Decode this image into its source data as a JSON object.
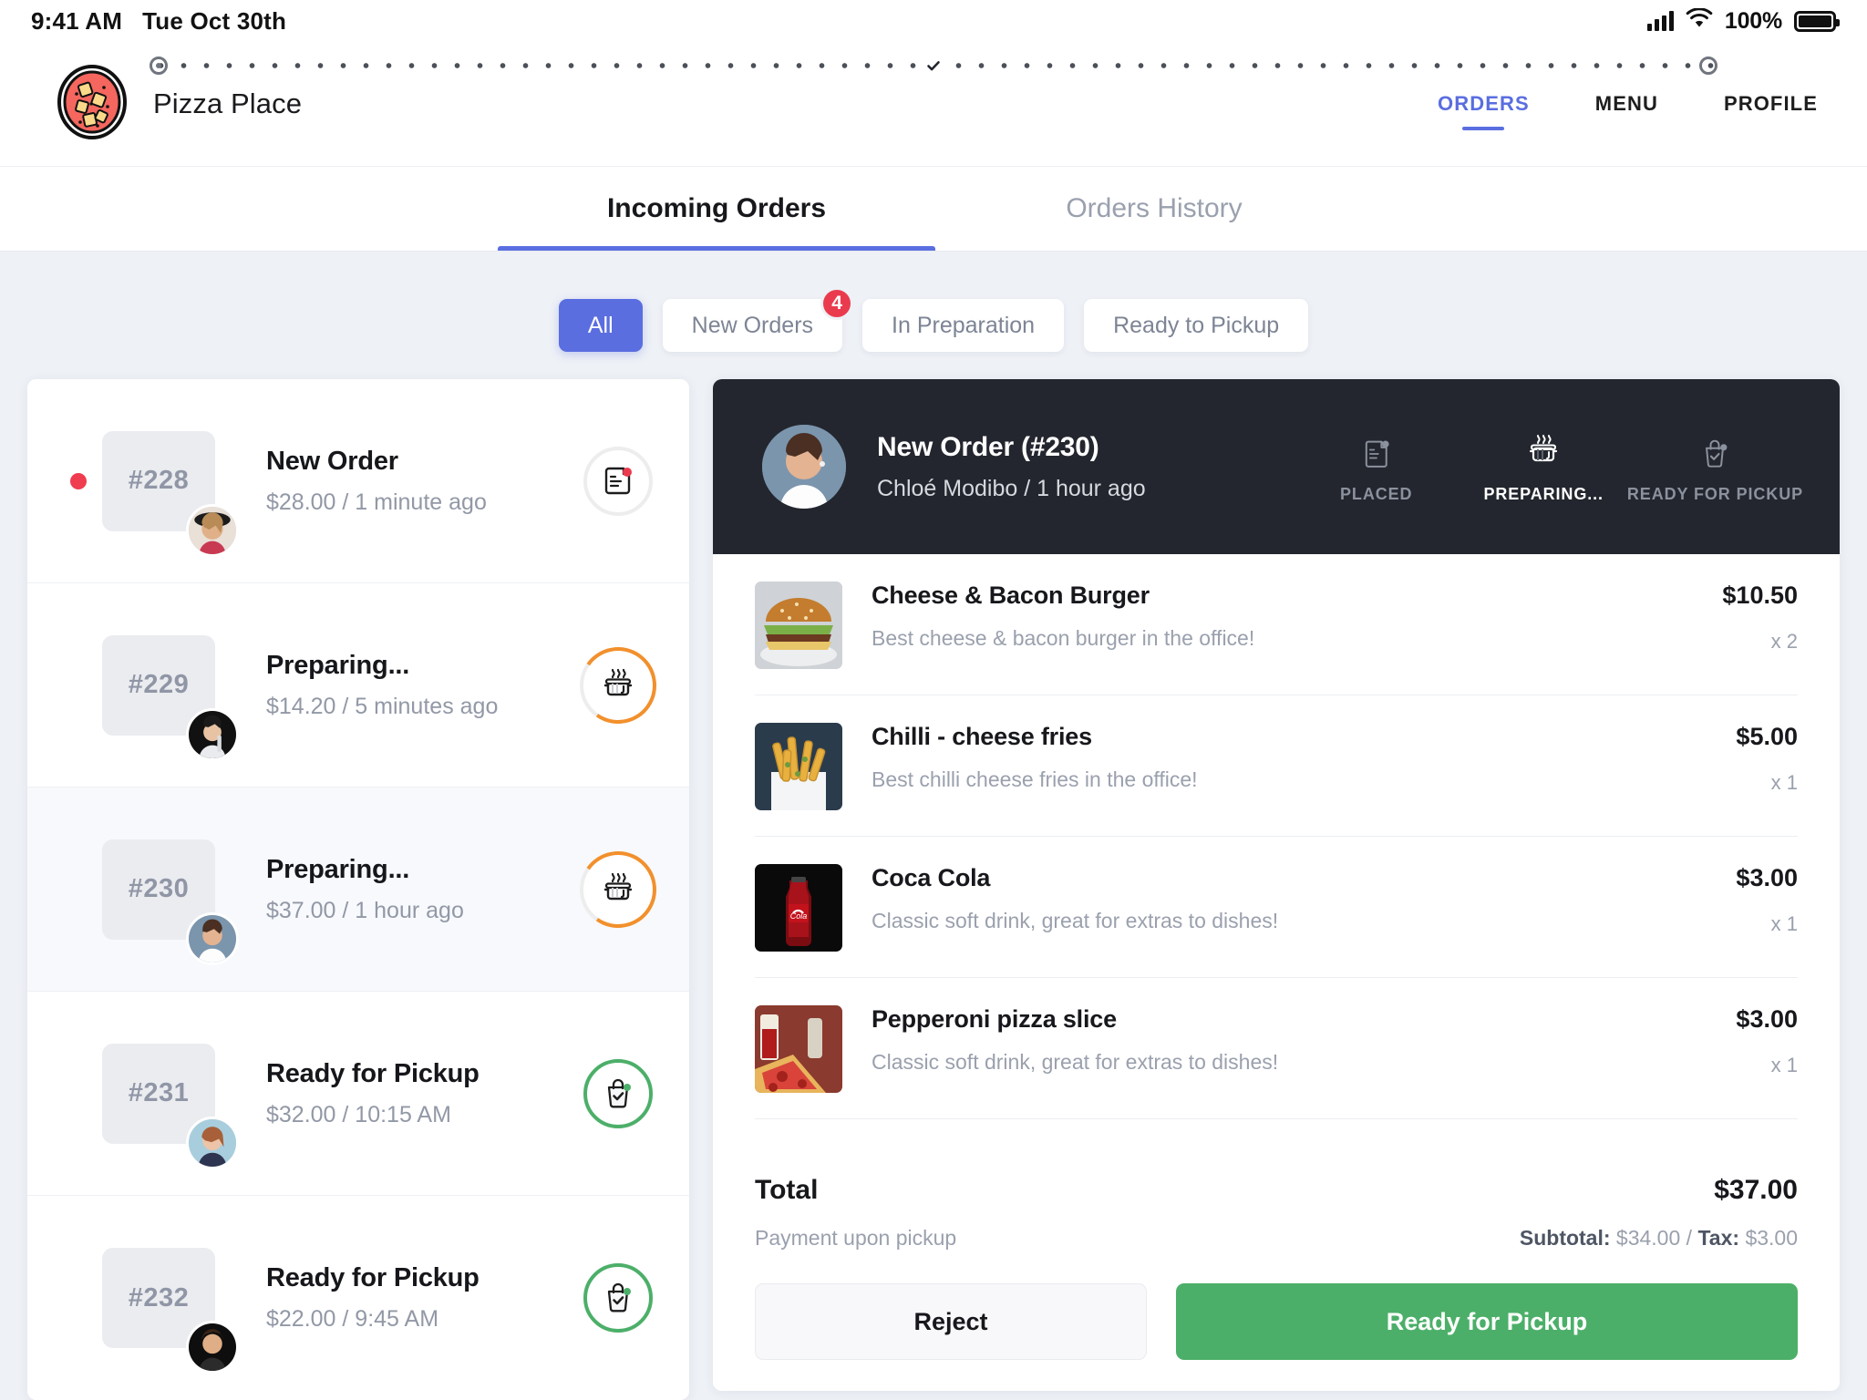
{
  "status_bar": {
    "time": "9:41 AM",
    "date": "Tue Oct 30th",
    "battery_percent": "100%",
    "signal_icon": "cellular-signal-icon",
    "wifi_icon": "wifi-icon",
    "battery_icon": "battery-full-icon"
  },
  "header": {
    "logo_icon": "pizza-logo-icon",
    "brand": "Pizza Place",
    "nav": [
      {
        "label": "ORDERS",
        "active": true
      },
      {
        "label": "MENU",
        "active": false
      },
      {
        "label": "PROFILE",
        "active": false
      }
    ]
  },
  "tabs": [
    {
      "label": "Incoming Orders",
      "active": true
    },
    {
      "label": "Orders History",
      "active": false
    }
  ],
  "filters": [
    {
      "label": "All",
      "active": true,
      "badge": ""
    },
    {
      "label": "New Orders",
      "active": false,
      "badge": "4"
    },
    {
      "label": "In Preparation",
      "active": false,
      "badge": ""
    },
    {
      "label": "Ready to Pickup",
      "active": false,
      "badge": ""
    }
  ],
  "orders": [
    {
      "number": "#228",
      "title": "New Order",
      "meta": "$28.00 / 1 minute ago",
      "status": "new",
      "icon": "receipt-icon",
      "selected": false,
      "unread": true
    },
    {
      "number": "#229",
      "title": "Preparing...",
      "meta": "$14.20 / 5 minutes ago",
      "status": "preparing",
      "icon": "cooking-pot-icon",
      "selected": false,
      "unread": false
    },
    {
      "number": "#230",
      "title": "Preparing...",
      "meta": "$37.00 / 1 hour ago",
      "status": "preparing",
      "icon": "cooking-pot-icon",
      "selected": true,
      "unread": false
    },
    {
      "number": "#231",
      "title": "Ready for Pickup",
      "meta": "$32.00 / 10:15 AM",
      "status": "ready",
      "icon": "shopping-bag-check-icon",
      "selected": false,
      "unread": false
    },
    {
      "number": "#232",
      "title": "Ready for Pickup",
      "meta": "$22.00 / 9:45 AM",
      "status": "ready",
      "icon": "shopping-bag-check-icon",
      "selected": false,
      "unread": false
    }
  ],
  "detail": {
    "title": "New Order (#230)",
    "subtitle": "Chloé Modibo / 1 hour ago",
    "customer_avatar": "customer-avatar",
    "steps": [
      {
        "label": "PLACED",
        "icon": "receipt-icon",
        "state": "done"
      },
      {
        "label": "PREPARING...",
        "icon": "cooking-pot-icon",
        "state": "current"
      },
      {
        "label": "READY FOR PICKUP",
        "icon": "shopping-bag-check-icon",
        "state": "pending"
      }
    ],
    "items": [
      {
        "name": "Cheese & Bacon Burger",
        "desc": "Best cheese & bacon burger in the office!",
        "price": "$10.50",
        "qty": "x 2",
        "image": "burger-photo"
      },
      {
        "name": "Chilli - cheese fries",
        "desc": "Best chilli cheese fries in the office!",
        "price": "$5.00",
        "qty": "x 1",
        "image": "fries-photo"
      },
      {
        "name": "Coca Cola",
        "desc": "Classic soft drink, great for extras to dishes!",
        "price": "$3.00",
        "qty": "x 1",
        "image": "cola-photo"
      },
      {
        "name": "Pepperoni pizza slice",
        "desc": "Classic soft drink, great for extras to dishes!",
        "price": "$3.00",
        "qty": "x 1",
        "image": "pizza-photo"
      }
    ],
    "total_label": "Total",
    "total_value": "$37.00",
    "payment_note": "Payment upon pickup",
    "subtotal_label": "Subtotal:",
    "subtotal_value": "$34.00",
    "separator": " / ",
    "tax_label": "Tax:",
    "tax_value": "$3.00",
    "reject_button": "Reject",
    "ready_button": "Ready for Pickup"
  },
  "colors": {
    "accent_blue": "#5a6ee0",
    "badge_red": "#ea3b4e",
    "preparing_orange": "#f2902c",
    "ready_green": "#4caf69",
    "dark_panel": "#23262e"
  }
}
